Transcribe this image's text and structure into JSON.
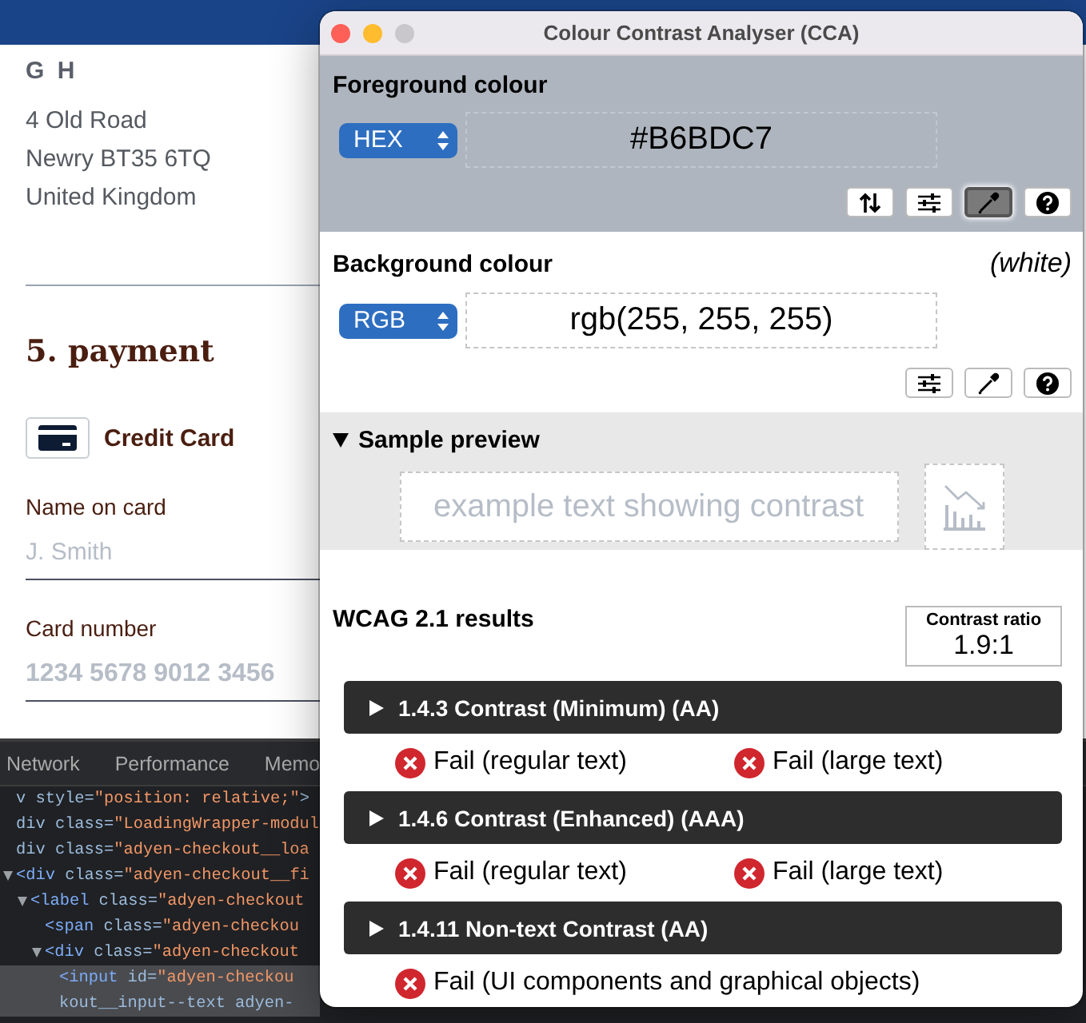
{
  "browser_page": {
    "recipient": "G H",
    "address_lines": [
      "4 Old Road",
      "Newry BT35 6TQ",
      "United Kingdom"
    ],
    "section_heading": "5. payment",
    "payment_method": {
      "label": "Credit Card"
    },
    "fields": [
      {
        "label": "Name on card",
        "placeholder": "J. Smith"
      },
      {
        "label": "Card number",
        "placeholder": "1234 5678 9012 3456"
      }
    ]
  },
  "devtools": {
    "tabs": [
      {
        "label": "Network",
        "selected": false
      },
      {
        "label": "Performance",
        "selected": false
      },
      {
        "label": "Memo",
        "selected": false
      }
    ],
    "dom_tree": [
      {
        "text": "v style=\"position: relative;\">",
        "expanded": false,
        "selected": false
      },
      {
        "text": "div class=\"LoadingWrapper-modul",
        "expanded": false,
        "selected": false
      },
      {
        "text": "div class=\"adyen-checkout__loa",
        "expanded": false,
        "selected": false
      },
      {
        "text": "<div class=\"adyen-checkout__fi",
        "expanded": true,
        "selected": false,
        "children": [
          {
            "text": "<label class=\"adyen-checkout",
            "expanded": true,
            "selected": false,
            "children": [
              {
                "text": "<span class=\"adyen-checkou",
                "expanded": false,
                "selected": false
              },
              {
                "text": "<div class=\"adyen-checkout",
                "expanded": true,
                "selected": false,
                "children": [
                  {
                    "text": "<input id=\"adyen-checkou",
                    "continuation": "kout__input--text adyen-",
                    "expanded": false,
                    "selected": true
                  }
                ]
              }
            ]
          }
        ]
      }
    ]
  },
  "cca_window": {
    "title": "Colour Contrast Analyser (CCA)",
    "foreground": {
      "heading": "Foreground colour",
      "format": "HEX",
      "value": "#B6BDC7",
      "tools": [
        {
          "kind": "swap",
          "pressed": false
        },
        {
          "kind": "sliders",
          "pressed": false
        },
        {
          "kind": "picker",
          "pressed": true
        },
        {
          "kind": "help",
          "pressed": false
        }
      ]
    },
    "background": {
      "heading": "Background colour",
      "colour_name": "(white)",
      "format": "RGB",
      "value": "rgb(255, 255, 255)",
      "tools": [
        {
          "kind": "sliders",
          "pressed": false
        },
        {
          "kind": "picker",
          "pressed": false
        },
        {
          "kind": "help",
          "pressed": false
        }
      ]
    },
    "sample_preview": {
      "heading": "Sample preview",
      "expanded": true,
      "sample_text": "example text showing contrast"
    },
    "results": {
      "heading": "WCAG 2.1 results",
      "ratio_label": "Contrast ratio",
      "ratio": "1.9:1",
      "criteria": [
        {
          "title": "1.4.3 Contrast (Minimum) (AA)",
          "expanded": false,
          "results": [
            {
              "label": "Fail (regular text)",
              "pass": false
            },
            {
              "label": "Fail (large text)",
              "pass": false
            }
          ]
        },
        {
          "title": "1.4.6 Contrast (Enhanced) (AAA)",
          "expanded": false,
          "results": [
            {
              "label": "Fail (regular text)",
              "pass": false
            },
            {
              "label": "Fail (large text)",
              "pass": false
            }
          ]
        },
        {
          "title": "1.4.11 Non-text Contrast (AA)",
          "expanded": false,
          "results": [
            {
              "label": "Fail (UI components and graphical objects)",
              "pass": false
            }
          ]
        }
      ]
    }
  }
}
